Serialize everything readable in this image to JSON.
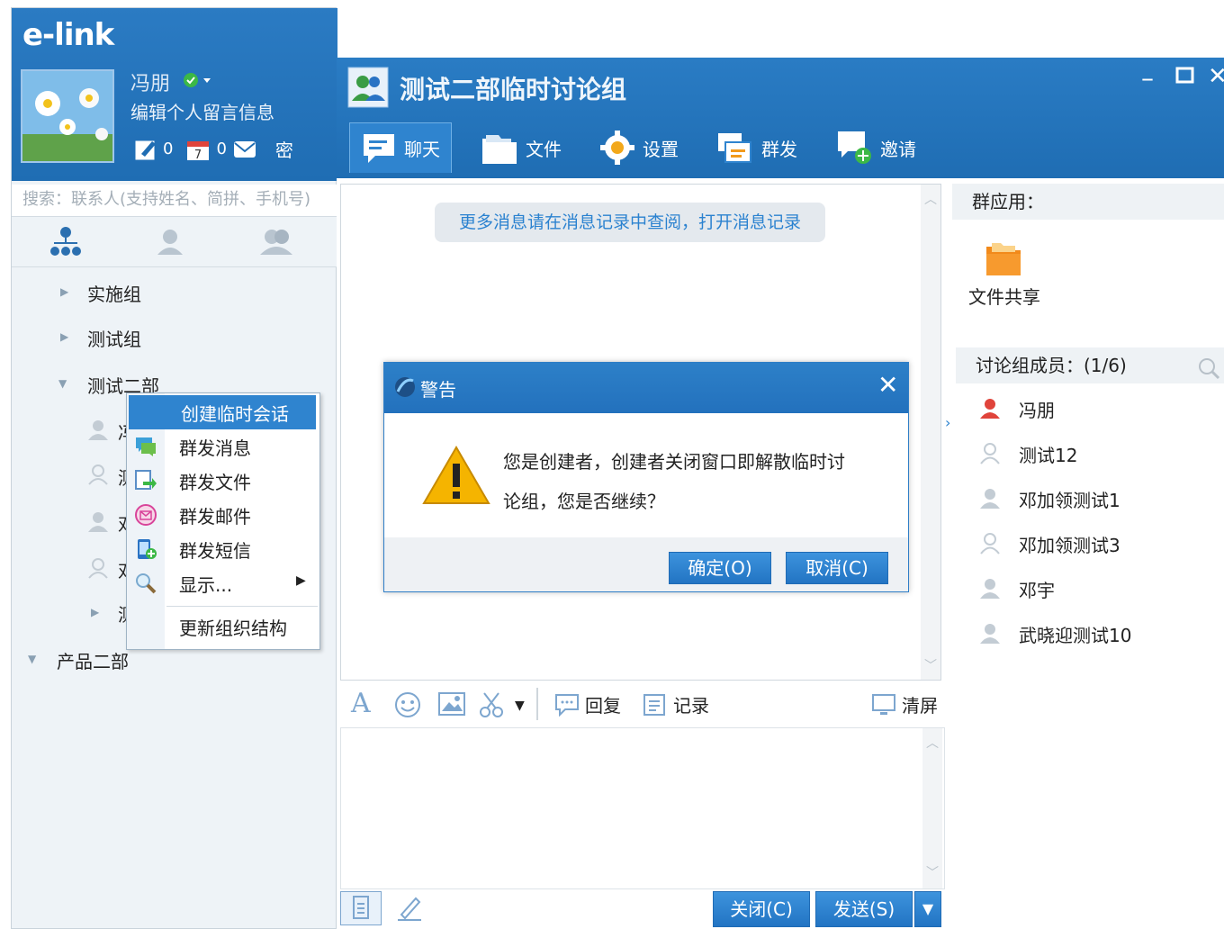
{
  "app": {
    "logo": "e-link",
    "minimize_glyph": "–",
    "close_glyph": "✕"
  },
  "user": {
    "name": "冯朋",
    "signature": "编辑个人留言信息",
    "notes_count": "0",
    "calendar_count": "0",
    "secret_label": "密"
  },
  "search": {
    "placeholder": "搜索：联系人(支持姓名、简拼、手机号)"
  },
  "contact_tabs": [
    "organization-icon",
    "person-icon",
    "group-icon"
  ],
  "tree": {
    "items": [
      "实施组",
      "测试组",
      "测试二部",
      "产品二部"
    ],
    "sub_initials": [
      "冯",
      "测",
      "邓",
      "邓",
      "测"
    ]
  },
  "context_menu": {
    "items": [
      "创建临时会话",
      "群发消息",
      "群发文件",
      "群发邮件",
      "群发短信",
      "显示...",
      "更新组织结构"
    ]
  },
  "chat": {
    "title": "测试二部临时讨论组",
    "tabs": [
      "聊天",
      "文件",
      "设置",
      "群发",
      "邀请"
    ],
    "history_notice": "更多消息请在消息记录中查阅，打开消息记录",
    "toolbar": {
      "font_glyph": "A",
      "reply": "回复",
      "records": "记录",
      "clear": "清屏"
    },
    "close_btn": "关闭(C)",
    "send_btn": "发送(S)",
    "send_dropdown_glyph": "▼"
  },
  "right_panel": {
    "apps_header": "群应用：",
    "file_share": "文件共享",
    "members_header": "讨论组成员：(1/6)",
    "members": [
      {
        "name": "冯朋",
        "status": "online"
      },
      {
        "name": "测试12",
        "status": "offline"
      },
      {
        "name": "邓加领测试1",
        "status": "offline"
      },
      {
        "name": "邓加领测试3",
        "status": "offline"
      },
      {
        "name": "邓宇",
        "status": "offline"
      },
      {
        "name": "武晓迎测试10",
        "status": "offline"
      }
    ]
  },
  "dialog": {
    "title": "警告",
    "message_line1": "您是创建者，创建者关闭窗口即解散临时讨",
    "message_line2": "论组，您是否继续？",
    "ok": "确定(O)",
    "cancel": "取消(C)"
  },
  "colors": {
    "title_blue": "#1f6db3",
    "accent_blue": "#2b82d0",
    "online_red": "#e0443b",
    "warning_yellow": "#f5b400"
  }
}
